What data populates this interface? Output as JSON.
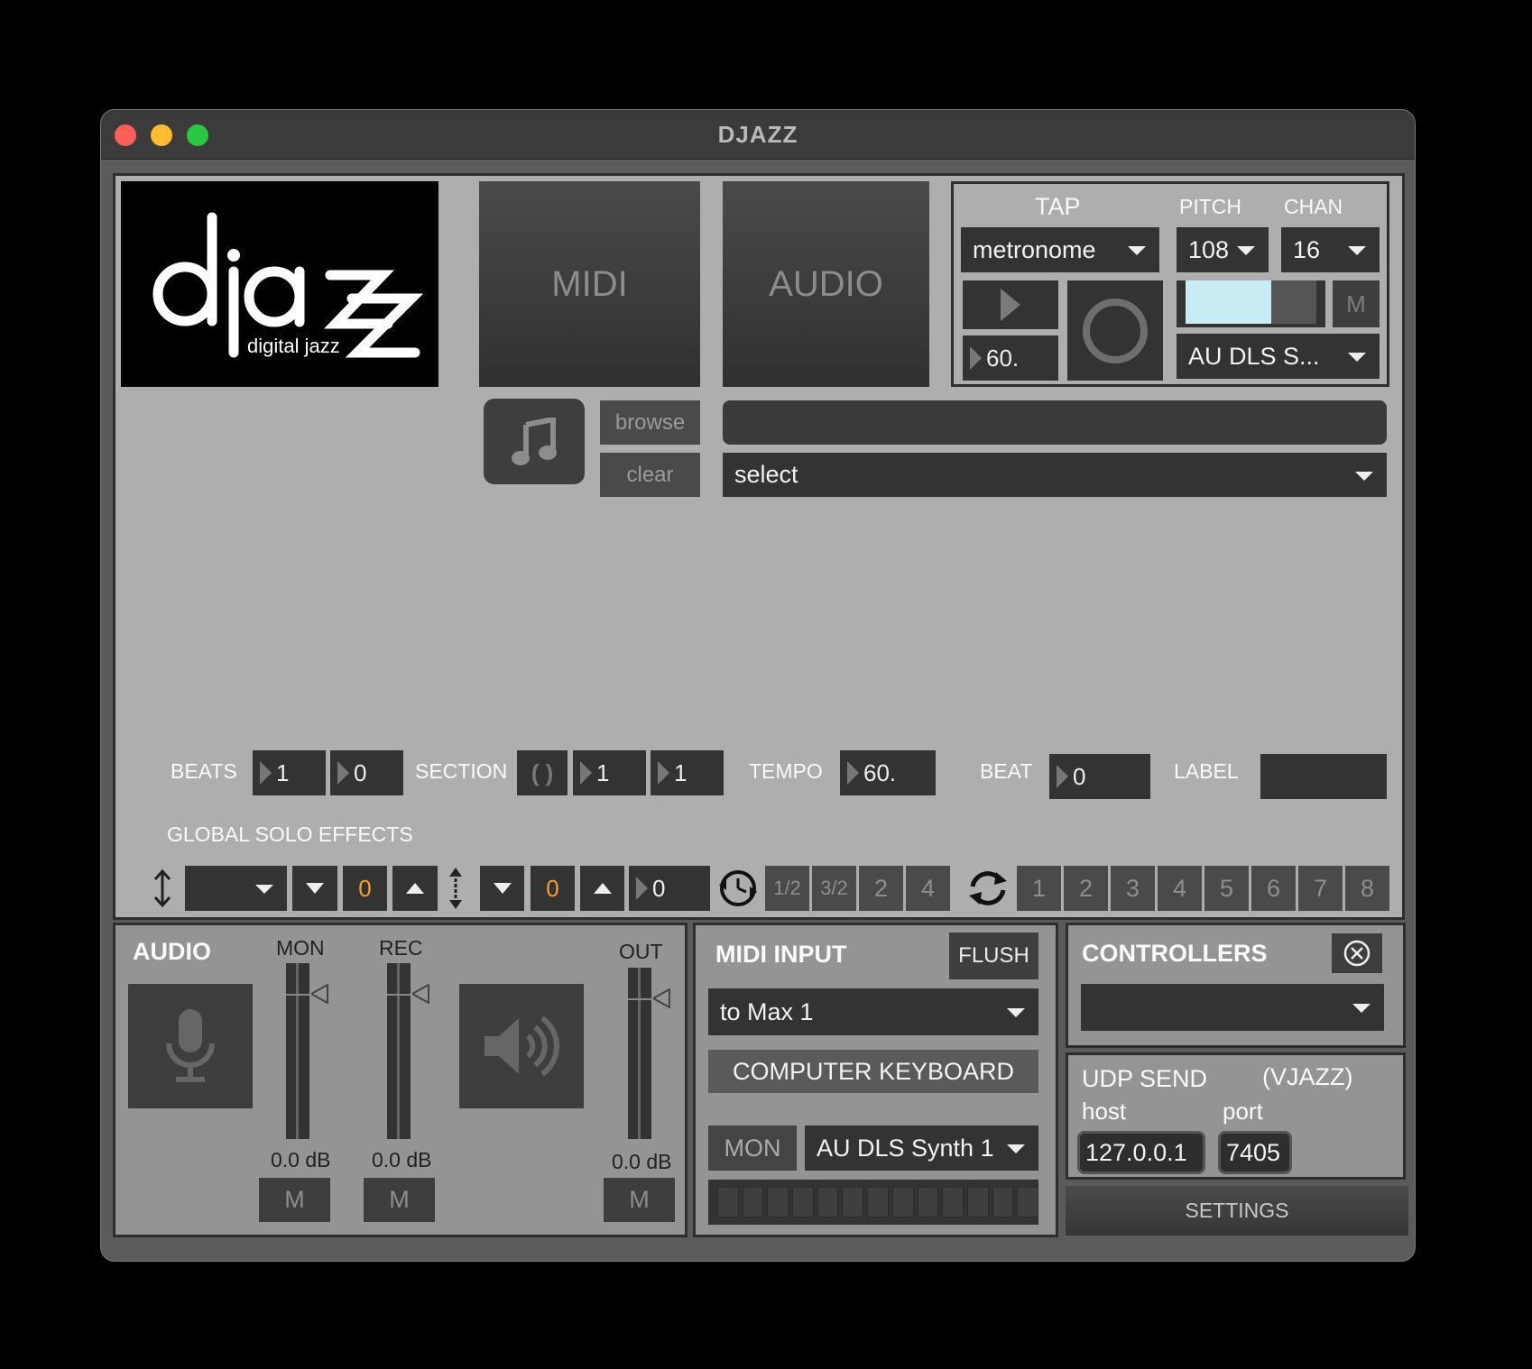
{
  "window": {
    "title": "DJAZZ"
  },
  "logo": {
    "word": "djazz",
    "tagline": "digital jazz"
  },
  "modes": {
    "midi": "MIDI",
    "audio": "AUDIO"
  },
  "tap": {
    "title": "TAP",
    "pitch_label": "PITCH",
    "chan_label": "CHAN",
    "sound": "metronome",
    "pitch": "108",
    "chan": "16",
    "tempo": "60.",
    "mute": "M",
    "synth": "AU DLS S..."
  },
  "file": {
    "browse": "browse",
    "clear": "clear",
    "path": "",
    "select": "select"
  },
  "transport": {
    "beats_label": "BEATS",
    "beats_1": "1",
    "beats_2": "0",
    "section_label": "SECTION",
    "section_1": "1",
    "section_2": "1",
    "tempo_label": "TEMPO",
    "tempo": "60.",
    "beat_label": "BEAT",
    "beat": "0",
    "label_label": "LABEL",
    "label": ""
  },
  "effects": {
    "title": "GLOBAL SOLO EFFECTS",
    "transpose": "0",
    "octave": "0",
    "num": "0",
    "speeds": [
      "1/2",
      "3/2",
      "2",
      "4"
    ],
    "loops": [
      "1",
      "2",
      "3",
      "4",
      "5",
      "6",
      "7",
      "8"
    ]
  },
  "audio": {
    "title": "AUDIO",
    "mon_label": "MON",
    "rec_label": "REC",
    "out_label": "OUT",
    "mon_db": "0.0 dB",
    "rec_db": "0.0 dB",
    "out_db": "0.0 dB",
    "mute": "M"
  },
  "midi_input": {
    "title": "MIDI INPUT",
    "flush": "FLUSH",
    "port": "to Max 1",
    "keyboard": "COMPUTER KEYBOARD",
    "mon": "MON",
    "synth": "AU DLS Synth 1"
  },
  "controllers": {
    "title": "CONTROLLERS",
    "selected": ""
  },
  "udp": {
    "title": "UDP SEND",
    "subtitle": "(VJAZZ)",
    "host_label": "host",
    "port_label": "port",
    "host": "127.0.0.1",
    "port": "7405"
  },
  "settings": "SETTINGS",
  "colors": {
    "accent_orange": "#f0a030",
    "tap_light": "#c8ecf4",
    "close": "#ff5f57",
    "minimize": "#febc2e",
    "zoom": "#28c840"
  }
}
